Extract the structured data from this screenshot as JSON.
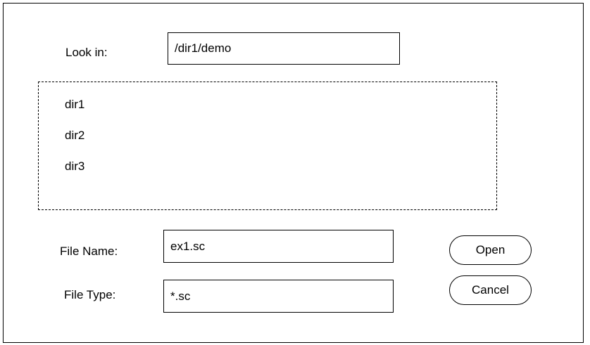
{
  "dialog": {
    "look_in": {
      "label": "Look in:",
      "value": "/dir1/demo"
    },
    "file_list": {
      "items": [
        "dir1",
        "dir2",
        "dir3"
      ]
    },
    "file_name": {
      "label": "File Name:",
      "value": "ex1.sc"
    },
    "file_type": {
      "label": "File Type:",
      "value": "*.sc"
    },
    "buttons": {
      "open_label": "Open",
      "cancel_label": "Cancel"
    }
  }
}
